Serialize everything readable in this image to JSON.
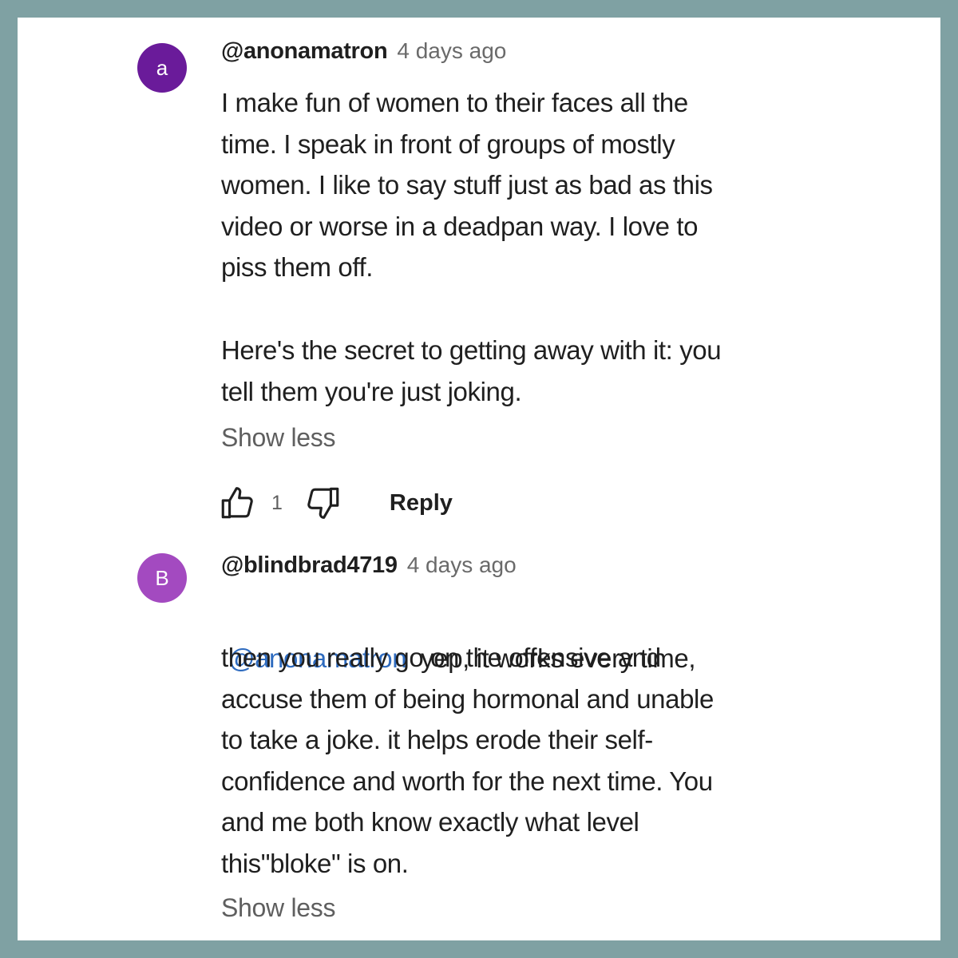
{
  "comments": [
    {
      "avatar_letter": "a",
      "avatar_color": "#6a1b9a",
      "handle": "@anonamatron",
      "time": "4 days ago",
      "paragraphs": [
        "I make fun of women to their faces all the\ntime.  I speak in front of groups of mostly\nwomen.  I like to say stuff just as bad as this\nvideo or worse in a deadpan way.  I love to\npiss them off.",
        "Here's the secret to getting away with it: you\ntell them you're just joking."
      ],
      "show_less": "Show less",
      "likes": "1",
      "reply_label": "Reply"
    },
    {
      "avatar_letter": "B",
      "avatar_color": "#a34ac0",
      "handle": "@blindbrad4719",
      "time": "4 days ago",
      "mention": "@anonamatron",
      "first_line_rest": "yep, it works every time,",
      "rest": "then you really go on the offensive and\naccuse them of being hormonal and unable\nto take a joke. it helps erode their self-\nconfidence and worth for the next time. You\nand me both know exactly what level\nthis\"bloke\" is on.",
      "show_less": "Show less"
    }
  ],
  "icons": {
    "like": "thumbs-up-outline",
    "dislike": "thumbs-down-outline"
  },
  "colors": {
    "frame": "#7fa1a3",
    "panel": "#ffffff",
    "text": "#1f1f1f",
    "secondary_text": "#6a6a6a",
    "mention": "#2e6bbf"
  }
}
